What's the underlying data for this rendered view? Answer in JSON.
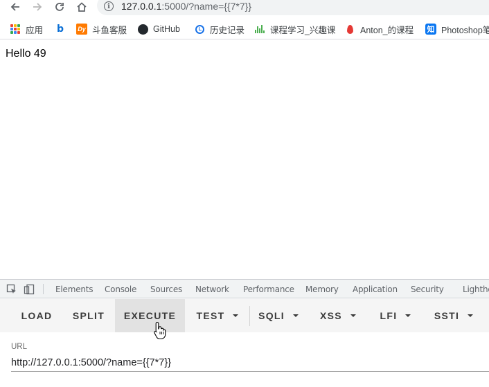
{
  "browser": {
    "address_bar": {
      "url_host": "127.0.0.1",
      "url_rest": ":5000/?name={{7*7}}"
    },
    "bookmarks": [
      {
        "label": "应用",
        "icon": "apps-grid-icon"
      },
      {
        "label": "",
        "icon": "bing-icon"
      },
      {
        "label": "斗鱼客服",
        "icon": "douyu-icon"
      },
      {
        "label": "GitHub",
        "icon": "github-icon"
      },
      {
        "label": "历史记录",
        "icon": "history-icon"
      },
      {
        "label": "课程学习_兴趣课",
        "icon": "soundwave-icon"
      },
      {
        "label": "Anton_的课程",
        "icon": "flame-icon"
      },
      {
        "label": "Photoshop笔",
        "icon": "zhihu-icon",
        "icon_text": "知"
      }
    ]
  },
  "page": {
    "content_text": "Hello 49"
  },
  "devtools": {
    "tabs": [
      "Elements",
      "Console",
      "Sources",
      "Network",
      "Performance",
      "Memory",
      "Application",
      "Security",
      "Lighthouse"
    ],
    "hackbar": {
      "buttons": [
        {
          "label": "LOAD"
        },
        {
          "label": "SPLIT"
        },
        {
          "label": "EXECUTE",
          "state": "hovered"
        },
        {
          "label": "TEST",
          "dropdown": true
        },
        {
          "label": "SQLI",
          "dropdown": true
        },
        {
          "label": "XSS",
          "dropdown": true
        },
        {
          "label": "LFI",
          "dropdown": true
        },
        {
          "label": "SSTI",
          "dropdown": true
        }
      ],
      "url_label": "URL",
      "url_value": "http://127.0.0.1:5000/?name={{7*7}}"
    }
  },
  "colors": {
    "accent": "#1a73e8",
    "hackbar_bg": "#f5f5f5",
    "hackbar_active": "#e2e2e2"
  }
}
